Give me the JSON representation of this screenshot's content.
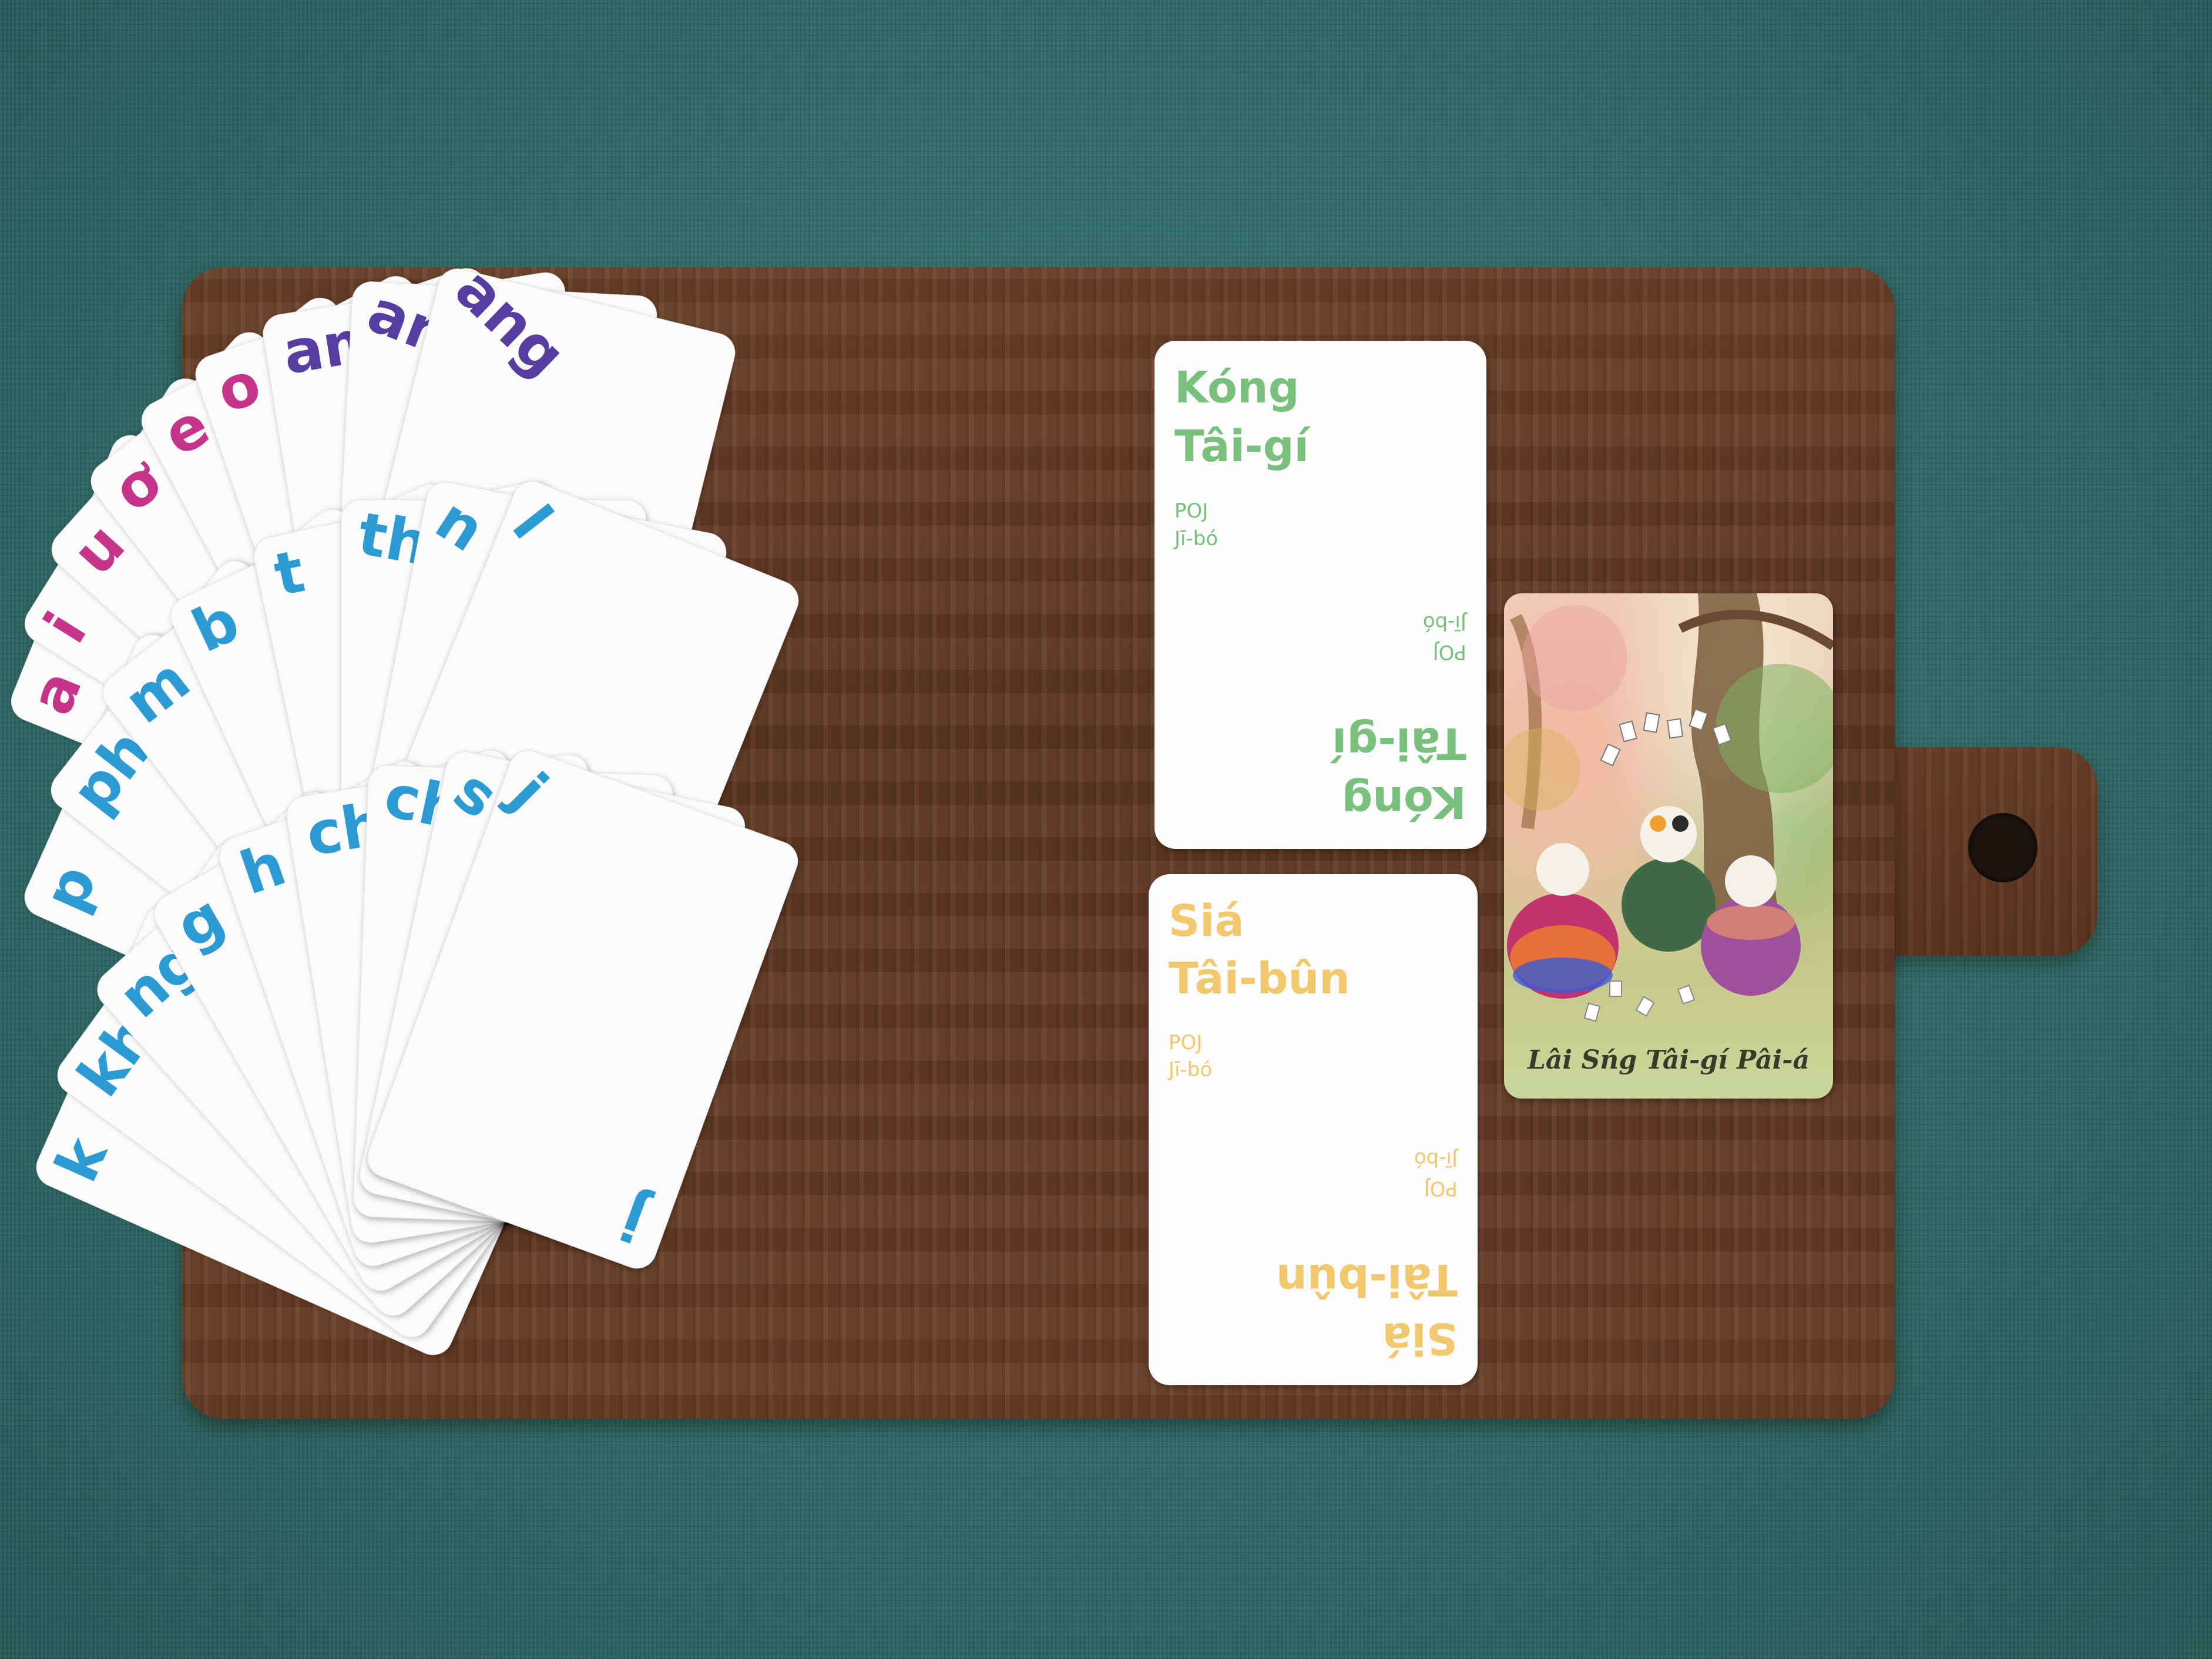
{
  "fan_vowels": {
    "cards": [
      {
        "text": "a",
        "color": "#c4348a"
      },
      {
        "text": "i",
        "color": "#c4348a"
      },
      {
        "text": "u",
        "color": "#c4348a"
      },
      {
        "text": "ơ",
        "color": "#c4348a"
      },
      {
        "text": "e",
        "color": "#c4348a"
      },
      {
        "text": "o",
        "color": "#c4348a"
      },
      {
        "text": "am",
        "color": "#553ea0"
      },
      {
        "text": "an",
        "color": "#553ea0"
      },
      {
        "text": "ang",
        "color": "#553ea0"
      }
    ]
  },
  "fan_consonants_1": {
    "cards": [
      {
        "text": "p",
        "color": "#2c9bd4"
      },
      {
        "text": "ph",
        "color": "#2c9bd4"
      },
      {
        "text": "m",
        "color": "#2c9bd4"
      },
      {
        "text": "b",
        "color": "#2c9bd4"
      },
      {
        "text": "t",
        "color": "#2c9bd4"
      },
      {
        "text": "th",
        "color": "#2c9bd4"
      },
      {
        "text": "n",
        "color": "#2c9bd4"
      },
      {
        "text": "l",
        "color": "#2c9bd4"
      }
    ]
  },
  "fan_consonants_2": {
    "cards": [
      {
        "text": "k",
        "color": "#2c9bd4"
      },
      {
        "text": "kh",
        "color": "#2c9bd4"
      },
      {
        "text": "ng",
        "color": "#2c9bd4"
      },
      {
        "text": "g",
        "color": "#2c9bd4"
      },
      {
        "text": "h",
        "color": "#2c9bd4"
      },
      {
        "text": "ch",
        "color": "#2c9bd4"
      },
      {
        "text": "chh",
        "color": "#2c9bd4"
      },
      {
        "text": "s",
        "color": "#2c9bd4"
      },
      {
        "text": "j",
        "color": "#2c9bd4"
      }
    ],
    "front_card_corner": "j"
  },
  "card_kong": {
    "title_line1": "Kóng",
    "title_line2": "Tâi-gí",
    "sub_line1": "POJ",
    "sub_line2": "Jī-bó",
    "color": "#78c07b"
  },
  "card_sia": {
    "title_line1": "Siá",
    "title_line2": "Tâi-bûn",
    "sub_line1": "POJ",
    "sub_line2": "Jī-bó",
    "color": "#f2c86e"
  },
  "cover_card": {
    "title": "Lâi Sńg Tâi-gí Pâi-á"
  }
}
